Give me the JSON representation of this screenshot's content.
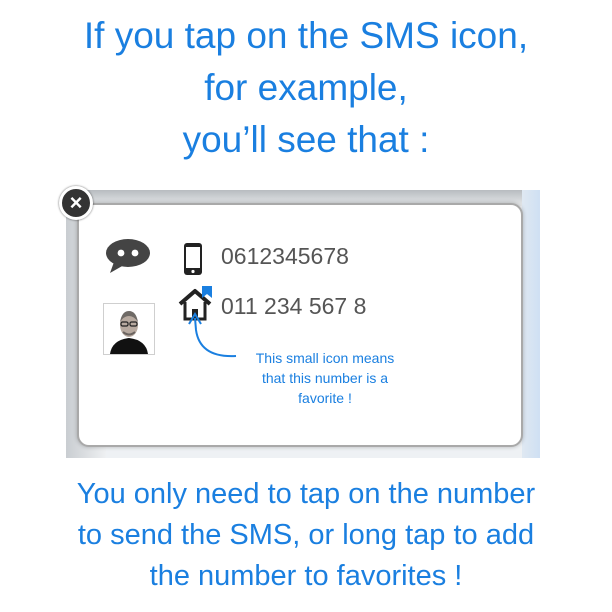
{
  "heading": {
    "line1": "If you tap on the SMS icon,",
    "line2": "for example,",
    "line3": "you’ll see that :"
  },
  "dialog": {
    "close_label": "×",
    "numbers": [
      {
        "value": "0612345678",
        "type_icon": "mobile-phone-icon",
        "favorite": false
      },
      {
        "value": "011 234 567 8",
        "type_icon": "home-icon",
        "favorite": true
      }
    ],
    "channel_icon": "sms-bubble-icon",
    "contact_icon": "contact-photo"
  },
  "annotation": {
    "line1": "This small icon means",
    "line2": "that this number is a",
    "line3": "favorite !"
  },
  "footer": {
    "line1": "You only need to tap on the number",
    "line2": "to send the SMS, or long tap to add",
    "line3": "the number to favorites !"
  },
  "colors": {
    "accent_blue": "#1a7fe0",
    "number_text": "#555555",
    "dialog_border": "#a9a9a9",
    "icon_dark": "#444444"
  }
}
